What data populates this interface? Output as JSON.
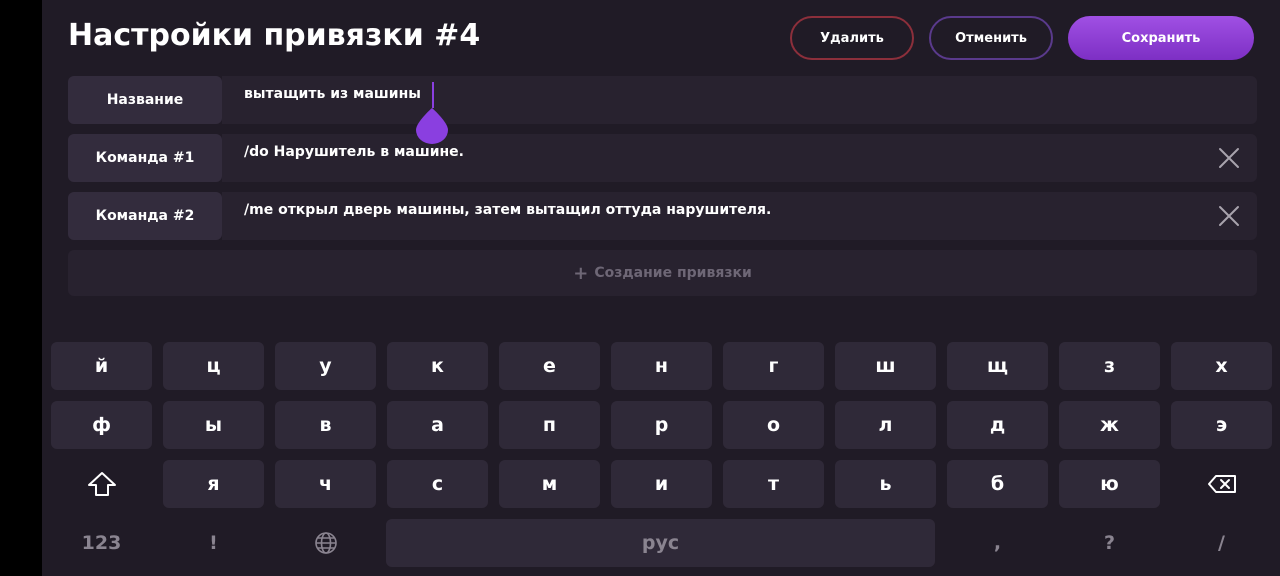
{
  "header": {
    "title": "Настройки привязки #4",
    "delete_label": "Удалить",
    "cancel_label": "Отменить",
    "save_label": "Сохранить"
  },
  "rows": [
    {
      "label": "Название",
      "value": "вытащить из машины",
      "clearable": false
    },
    {
      "label": "Команда #1",
      "value": "/do Нарушитель в машине.",
      "clearable": true
    },
    {
      "label": "Команда #2",
      "value": "/me открыл дверь машины, затем вытащил оттуда нарушителя.",
      "clearable": true
    }
  ],
  "create_binding_label": "Создание привязки",
  "icons": {
    "clear": "close-icon",
    "add": "plus-icon",
    "shift": "shift-icon",
    "backspace": "backspace-icon",
    "language": "globe-icon",
    "text_cursor": "text-cursor-handle-icon"
  },
  "keyboard": {
    "row1": [
      "й",
      "ц",
      "у",
      "к",
      "е",
      "н",
      "г",
      "ш",
      "щ",
      "з",
      "х"
    ],
    "row2": [
      "ф",
      "ы",
      "в",
      "а",
      "п",
      "р",
      "о",
      "л",
      "д",
      "ж",
      "э"
    ],
    "row3": [
      "я",
      "ч",
      "с",
      "м",
      "и",
      "т",
      "ь",
      "б",
      "ю"
    ],
    "numbers_key": "123",
    "exclaim_key": "!",
    "space_label": "рус",
    "comma_key": ",",
    "question_key": "?",
    "slash_key": "/"
  },
  "colors": {
    "background": "#201b26",
    "accent": "#8a3fe0",
    "delete_border": "#8c2f3b",
    "cancel_border": "#5a3a8c"
  }
}
